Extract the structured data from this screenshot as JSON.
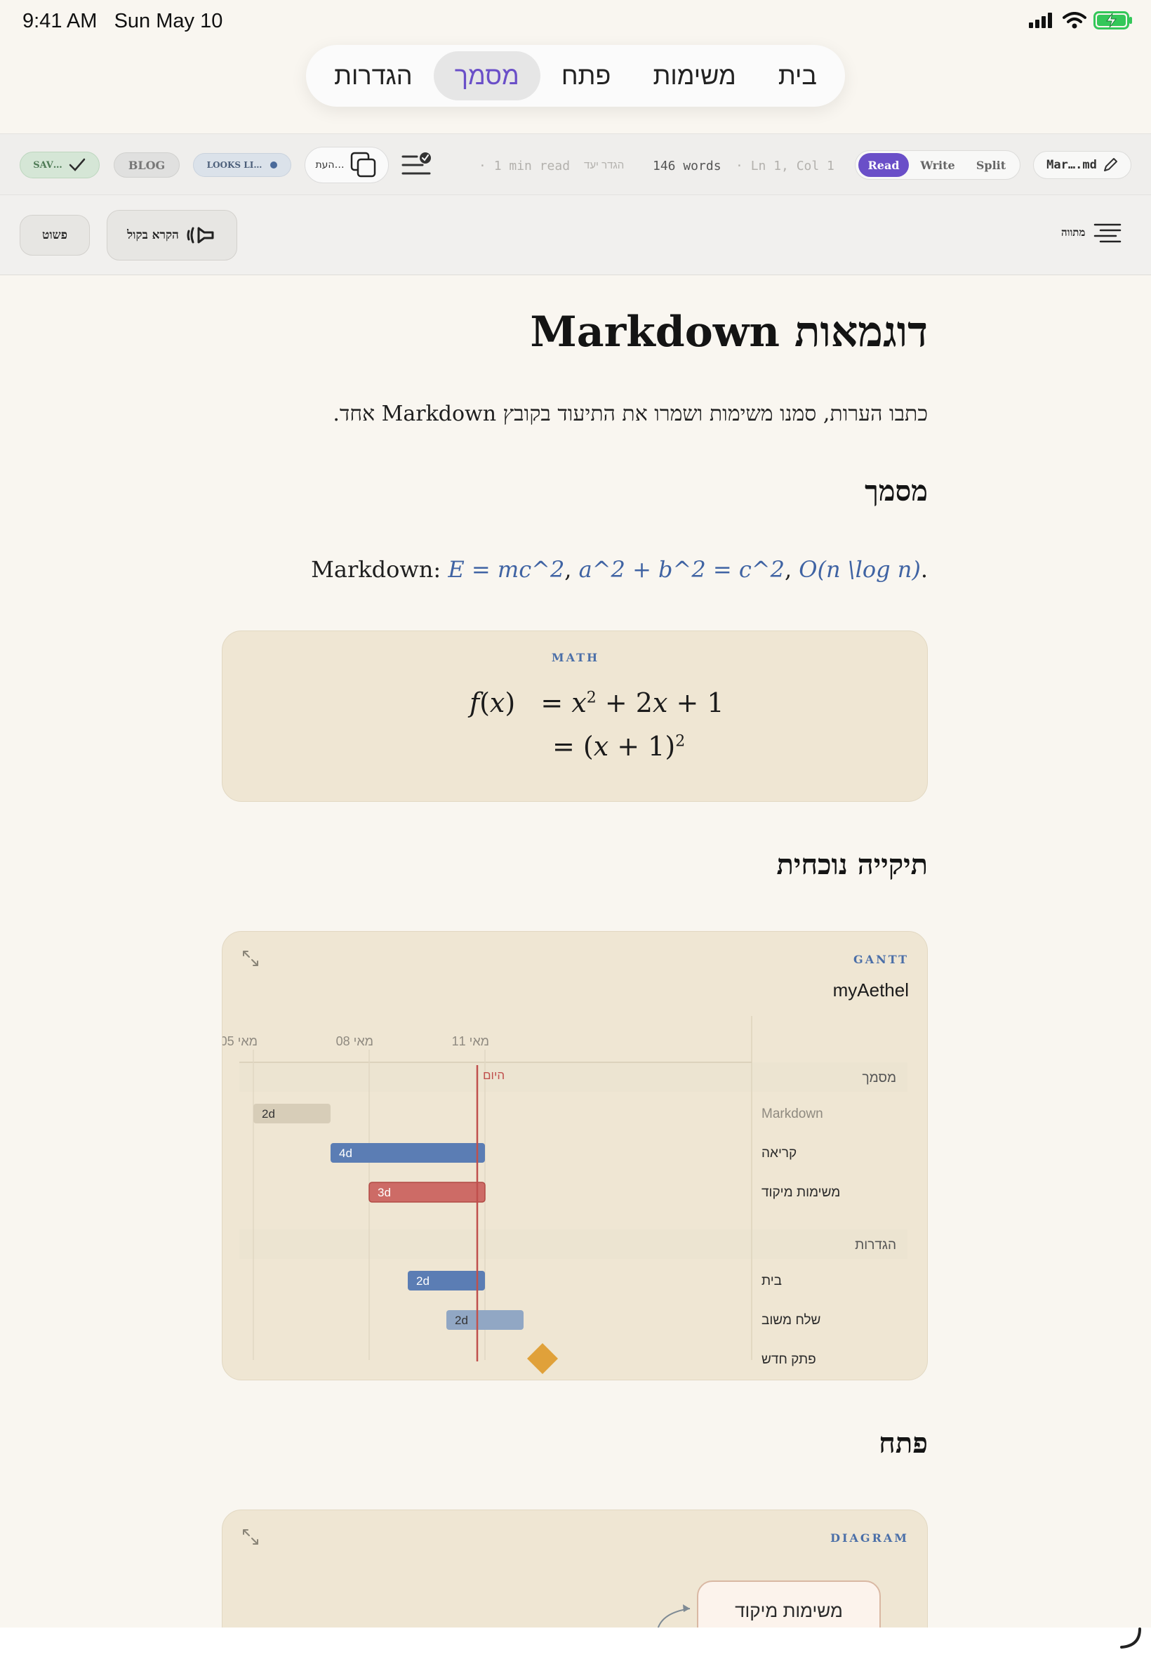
{
  "status_bar": {
    "time": "9:41 AM",
    "date": "Sun May 10"
  },
  "nav": {
    "tabs": [
      "בית",
      "משימות",
      "פתח",
      "מסמך",
      "הגדרות"
    ],
    "active": "מסמך"
  },
  "toolbar": {
    "file_name": "Mar….md",
    "view_modes": [
      "Read",
      "Write",
      "Split"
    ],
    "active_mode": "Read",
    "cursor_pos": "Ln 1, Col 1",
    "word_count": "146 words",
    "goal_label": "הגדר יעד",
    "read_time": "1 min read",
    "copy_label": "העת…",
    "looks_label": "LOOKS LI…",
    "blog_label": "BLOG",
    "saved_label": "SAV…"
  },
  "toolbar2": {
    "outline_label": "מתווה",
    "read_aloud_label": "הקרא בקול",
    "simple_label": "פשוט"
  },
  "document": {
    "title": "דוגמאות Markdown",
    "intro": "כתבו הערות, סמנו משימות ושמרו את התיעוד בקובץ Markdown אחד.",
    "section_doc": "מסמך",
    "math_line_prefix": "Markdown:",
    "math_inline": [
      "E = mc^2",
      "a^2 + b^2 = c^2",
      "O(n \\log n)"
    ],
    "math_card_label": "MATH",
    "section_folder": "תיקייה נוכחית",
    "section_open": "פתח",
    "diagram_label": "DIAGRAM",
    "diagram_node": "משימות מיקוד"
  },
  "gantt": {
    "card_label": "GANTT",
    "title": "myAethel",
    "axis_ticks": [
      "מאי 05",
      "מאי 08",
      "מאי 11"
    ],
    "today_label": "היום",
    "sections": [
      "מסמך",
      "הגדרות"
    ],
    "tasks": [
      {
        "name": "Markdown",
        "section": "מסמך",
        "start": "מאי 05",
        "duration": "2d",
        "status": "done"
      },
      {
        "name": "קריאה",
        "section": "מסמך",
        "start": "מאי 07",
        "duration": "4d",
        "status": "active"
      },
      {
        "name": "משימות מיקוד",
        "section": "מסמך",
        "start": "מאי 08",
        "duration": "3d",
        "status": "critical"
      },
      {
        "name": "בית",
        "section": "הגדרות",
        "start": "מאי 09",
        "duration": "2d",
        "status": "active"
      },
      {
        "name": "שלח משוב",
        "section": "הגדרות",
        "start": "מאי 10",
        "duration": "2d",
        "status": "planned"
      },
      {
        "name": "פתק חדש",
        "section": "הגדרות",
        "start": "מאי 12",
        "duration": "",
        "status": "milestone"
      }
    ]
  },
  "colors": {
    "accent": "#6a4fc8",
    "page_bg": "#f9f6f0",
    "card_bg": "#efe6d3",
    "bar_active": "#5b7db4",
    "bar_critical": "#cd6b66",
    "bar_done": "#d7cdb8",
    "bar_planned": "#91a7c4",
    "milestone": "#e0a13a",
    "today_line": "#c0504d",
    "math_blue": "#3f63a3"
  }
}
